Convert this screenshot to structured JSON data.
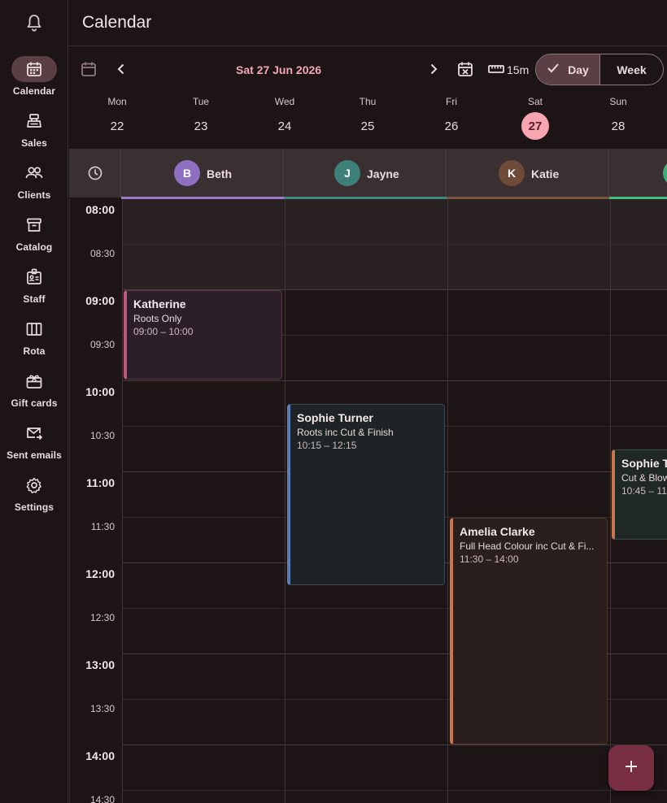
{
  "header": {
    "title": "Calendar"
  },
  "sidebar": {
    "items": [
      {
        "label": "Calendar",
        "icon": "calendar-icon",
        "active": true
      },
      {
        "label": "Sales",
        "icon": "register-icon"
      },
      {
        "label": "Clients",
        "icon": "people-icon"
      },
      {
        "label": "Catalog",
        "icon": "archive-icon"
      },
      {
        "label": "Staff",
        "icon": "badge-icon"
      },
      {
        "label": "Rota",
        "icon": "columns-icon"
      },
      {
        "label": "Gift cards",
        "icon": "gift-card-icon"
      },
      {
        "label": "Sent emails",
        "icon": "email-sent-icon"
      },
      {
        "label": "Settings",
        "icon": "gear-icon"
      }
    ]
  },
  "toolbar": {
    "date": "Sat 27 Jun 2026",
    "interval": "15m",
    "view_day": "Day",
    "view_week": "Week",
    "active_view": "Day"
  },
  "week": [
    {
      "name": "Mon",
      "num": "22"
    },
    {
      "name": "Tue",
      "num": "23"
    },
    {
      "name": "Wed",
      "num": "24"
    },
    {
      "name": "Thu",
      "num": "25"
    },
    {
      "name": "Fri",
      "num": "26"
    },
    {
      "name": "Sat",
      "num": "27",
      "selected": true
    },
    {
      "name": "Sun",
      "num": "28"
    }
  ],
  "staff": [
    {
      "initial": "B",
      "name": "Beth",
      "color": "#8e6fc0",
      "line": "#9b7ad0"
    },
    {
      "initial": "J",
      "name": "Jayne",
      "color": "#3d8078",
      "line": "#3e8a80"
    },
    {
      "initial": "K",
      "name": "Katie",
      "color": "#6e4a38",
      "line": "#7a553f"
    },
    {
      "initial": "",
      "name": "",
      "color": "#3fb07a",
      "line": "#3fbf84"
    }
  ],
  "times": [
    "08:00",
    "08:30",
    "09:00",
    "09:30",
    "10:00",
    "10:30",
    "11:00",
    "11:30",
    "12:00",
    "12:30",
    "13:00",
    "13:30",
    "14:00",
    "14:30"
  ],
  "appointments": [
    {
      "name": "Katherine",
      "service": "Roots Only",
      "time": "09:00 – 10:00"
    },
    {
      "name": "Sophie Turner",
      "service": "Roots inc Cut & Finish",
      "time": "10:15 – 12:15"
    },
    {
      "name": "Amelia Clarke",
      "service": "Full Head Colour inc Cut & Fi...",
      "time": "11:30 – 14:00"
    },
    {
      "name": "Sophie T",
      "service": "Cut & Blow",
      "time": "10:45 – 11"
    }
  ],
  "colors": {
    "accent": "#f6a5b1",
    "fab": "#7a2e44",
    "katherine_bar": "#c0587e",
    "sophie_bar": "#5a7fb8",
    "amelia_bar": "#c8774a",
    "sophie2_bar": "#c8774a"
  }
}
